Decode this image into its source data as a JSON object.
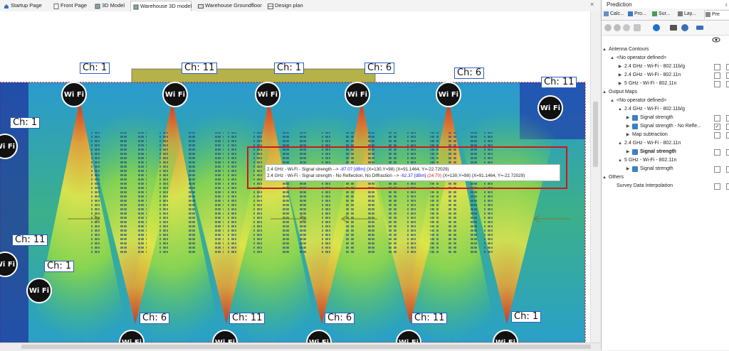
{
  "tabs": [
    {
      "label": "Startup Page",
      "icon": "home-icon",
      "color": "#3a6fb7"
    },
    {
      "label": "Front Page",
      "icon": "page-icon",
      "color": "#6b6b6b"
    },
    {
      "label": "3D Model",
      "icon": "cube-icon",
      "color": "#6b6b6b"
    },
    {
      "label": "Warehouse 3D model",
      "icon": "cube-icon",
      "color": "#6b6b6b",
      "active": true
    },
    {
      "label": "Warehouse Groundfloor",
      "icon": "floor-icon",
      "color": "#6b6b6b"
    },
    {
      "label": "Design plan",
      "icon": "plan-icon",
      "color": "#6b6b6b"
    }
  ],
  "tab_close": "×",
  "panel": {
    "title": "Prediction",
    "pin": "♁",
    "tabs": [
      {
        "label": "Calc...",
        "icon": "calculator-icon"
      },
      {
        "label": "Pro...",
        "icon": "project-icon"
      },
      {
        "label": "Sur...",
        "icon": "survey-icon"
      },
      {
        "label": "Lay...",
        "icon": "layers-icon"
      },
      {
        "label": "Pre",
        "icon": "prediction-icon"
      }
    ],
    "toolbar": [
      "add-icon",
      "remove-icon",
      "settings-icon",
      "plugin-icon",
      "play-icon",
      "list-icon",
      "history-icon",
      "split-icon"
    ],
    "header_icon": "eye-icon",
    "tree": [
      {
        "label": "Antenna Contours",
        "level": 0,
        "exp": "▲",
        "check": "none"
      },
      {
        "label": "<No operator defined>",
        "level": 1,
        "exp": "▲",
        "check": "none"
      },
      {
        "label": "2.4 GHz - Wi-Fi - 802.11b/g",
        "level": 2,
        "exp": "▶",
        "check": "box"
      },
      {
        "label": "2.4 GHz - Wi-Fi - 802.11n",
        "level": 2,
        "exp": "▶",
        "check": "box"
      },
      {
        "label": "5 GHz - Wi-Fi - 802.11n",
        "level": 2,
        "exp": "▶",
        "check": "box"
      },
      {
        "label": "Output Maps",
        "level": 0,
        "exp": "▲",
        "check": "none"
      },
      {
        "label": "<No operator defined>",
        "level": 1,
        "exp": "▲",
        "check": "none"
      },
      {
        "label": "2.4 GHz - Wi-Fi - 802.11b/g",
        "level": 2,
        "exp": "▲",
        "check": "none"
      },
      {
        "label": "Signal strength",
        "level": 3,
        "exp": "▶",
        "check": "box",
        "icon": true
      },
      {
        "label": "Signal strength - No Refle...",
        "level": 3,
        "exp": "▶",
        "check": "checked",
        "icon": true
      },
      {
        "label": "Map subtraction",
        "level": 3,
        "exp": "▶",
        "check": "box"
      },
      {
        "label": "2.4 GHz - Wi-Fi - 802.11n",
        "level": 2,
        "exp": "▲",
        "check": "none"
      },
      {
        "label": "Signal strength",
        "level": 3,
        "exp": "▶",
        "check": "box",
        "icon": true,
        "bold": true
      },
      {
        "label": "5 GHz - Wi-Fi - 802.11n",
        "level": 2,
        "exp": "▲",
        "check": "none"
      },
      {
        "label": "Signal strength",
        "level": 3,
        "exp": "▶",
        "check": "box",
        "icon": true
      },
      {
        "label": "Others",
        "level": 0,
        "exp": "▲",
        "check": "none"
      },
      {
        "label": "Survey Data Interpolation",
        "level": 1,
        "exp": "",
        "check": "box"
      }
    ]
  },
  "tooltip": {
    "line1": {
      "prefix": "2.4 GHz - Wi-Fi -   Signal strength -->  ",
      "value": "-87.07 [dBm]",
      "suffix": "  (X=130,Y=98)  (X=91.1464, Y=-22.72029)"
    },
    "line2": {
      "prefix": "2.4 GHz - Wi-Fi -   Signal strength - No Reflection, No Diffraction -->  ",
      "value": "-62.37 [dBm]",
      "delta": "(24.70)",
      "suffix": "  (X=130,Y=98)  (X=91.1464, Y=-22.72029)"
    }
  },
  "antennas": [
    {
      "channel": "Ch: 1",
      "wifi": "Wi Fi"
    },
    {
      "channel": "Ch: 11",
      "wifi": "Wi Fi"
    },
    {
      "channel": "Ch: 1",
      "wifi": "Wi Fi"
    },
    {
      "channel": "Ch: 6",
      "wifi": "Wi Fi"
    },
    {
      "channel": "Ch: 6",
      "wifi": "Wi Fi"
    },
    {
      "channel": "Ch: 11",
      "wifi": "Wi Fi"
    },
    {
      "channel": "Ch: 1",
      "wifi": "Wi Fi"
    },
    {
      "channel": "Ch: 11",
      "wifi": "Wi Fi"
    },
    {
      "channel": "Ch: 1",
      "wifi": "Wi Fi"
    },
    {
      "channel": "Ch: 6",
      "wifi": "Wi Fi"
    },
    {
      "channel": "Ch: 11",
      "wifi": "Wi Fi"
    },
    {
      "channel": "Ch: 6",
      "wifi": "Wi Fi"
    },
    {
      "channel": "Ch: 11",
      "wifi": "Wi Fi"
    },
    {
      "channel": "Ch: 1",
      "wifi": "Wi Fi"
    }
  ],
  "colors": {
    "highlight": "#d0151b",
    "accent": "#2a5fbf",
    "heat_low": "#1a2fa0",
    "heat_mid": "#33c06a",
    "heat_high": "#e0301a"
  }
}
